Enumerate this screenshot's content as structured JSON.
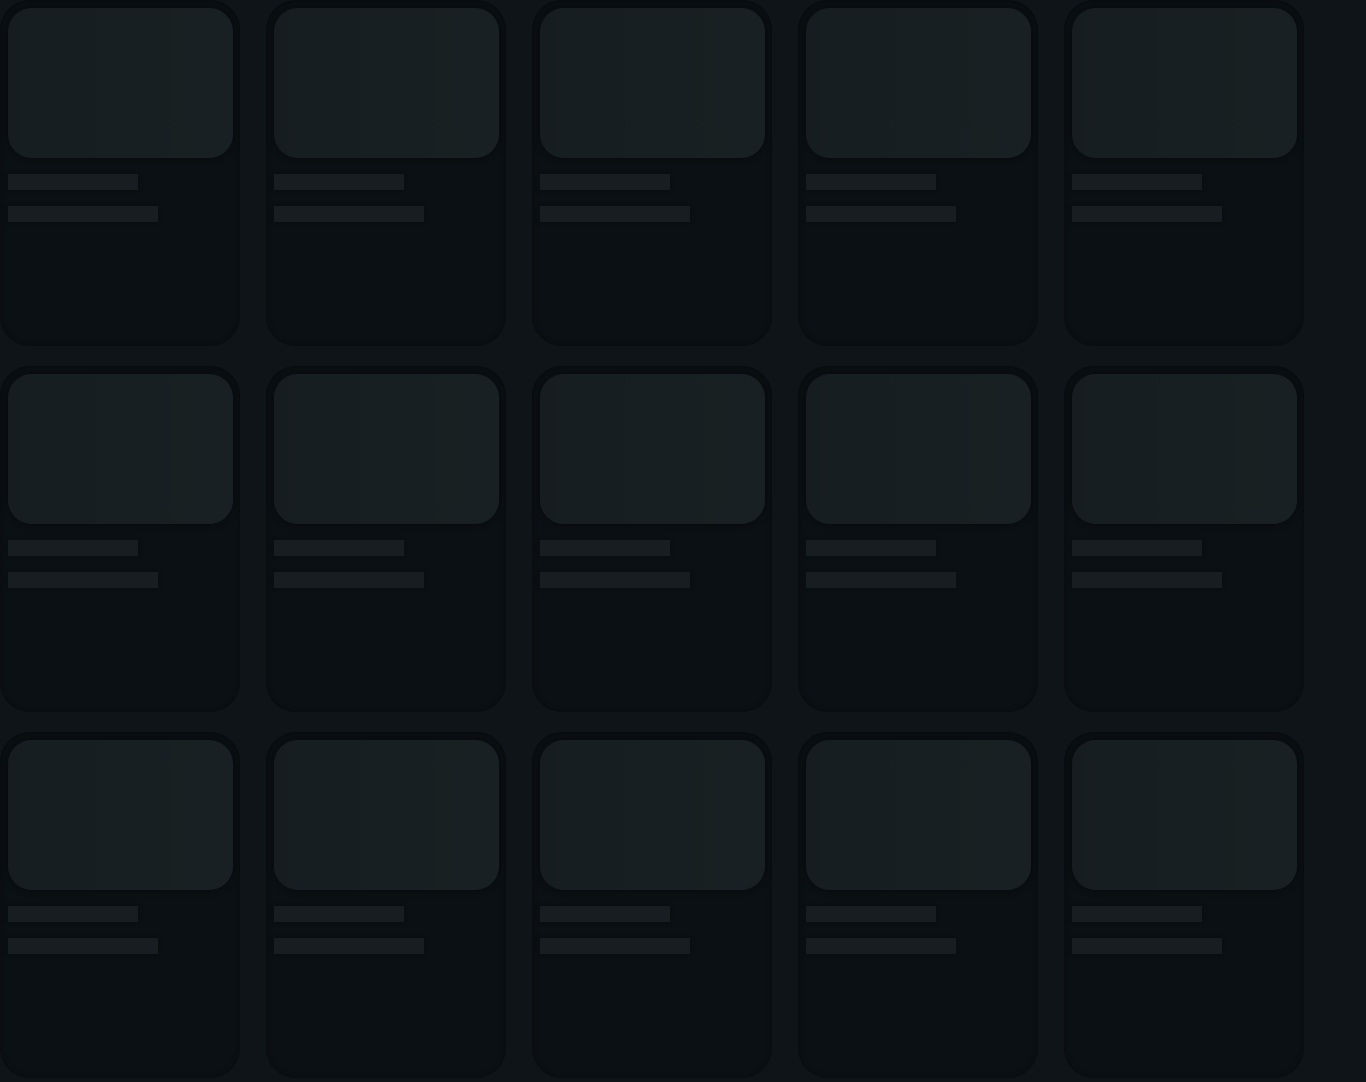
{
  "colors": {
    "page_background": "#0e1418",
    "card_background": "#0b1014",
    "placeholder": "#182023"
  },
  "state": "loading-skeleton",
  "grid": {
    "rows": 3,
    "columns": 5,
    "cards": [
      {
        "kind": "skeleton"
      },
      {
        "kind": "skeleton"
      },
      {
        "kind": "skeleton"
      },
      {
        "kind": "skeleton"
      },
      {
        "kind": "skeleton"
      },
      {
        "kind": "skeleton"
      },
      {
        "kind": "skeleton"
      },
      {
        "kind": "skeleton"
      },
      {
        "kind": "skeleton"
      },
      {
        "kind": "skeleton"
      },
      {
        "kind": "skeleton"
      },
      {
        "kind": "skeleton"
      },
      {
        "kind": "skeleton"
      },
      {
        "kind": "skeleton"
      },
      {
        "kind": "skeleton"
      }
    ]
  }
}
